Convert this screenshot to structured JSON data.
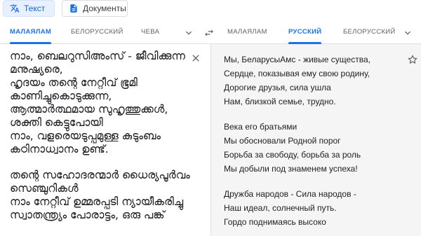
{
  "modes": {
    "text_label": "Текст",
    "docs_label": "Документы"
  },
  "source_langs": [
    "МАЛАЯЛАМ",
    "БЕЛОРУССКИЙ",
    "ЧЕВА"
  ],
  "target_langs": [
    "МАЛАЯЛАМ",
    "РУССКИЙ",
    "БЕЛОРУССКИЙ"
  ],
  "source_text": {
    "stanza1": [
      "നാം, ബെലറുസിഅംസ് - ജീവിക്കുന്ന",
      "മനുഷ്യരെ,",
      "ഹൃദയം തന്റെ നേറ്റീവ് ഭൂമി",
      "കാണിച്ചുകൊടുക്കുന്ന,",
      "ആത്മാർത്ഥമായ സുഹൃത്തുക്കൾ,",
      "ശക്തി കെട്ടുപോയി",
      "നാം, വളരെയടുപ്പമുള്ള കുടുംബം",
      "കഠിനാധ്വാനം ഉണ്ട്."
    ],
    "stanza2": [
      "തന്റെ സഹോദരന്മാർ ധൈര്യപൂർവം",
      "സെഞ്ചുറികൾ",
      "നാം നേറ്റീവ് ഉമ്മരപ്പടി ന്യായീകരിച്ചു",
      "സ്വാതന്ത്ര്യം പോരാട്ടം, ഒരു പങ്ക്"
    ]
  },
  "translation": {
    "stanza1": [
      "Мы, БеларусыАмс - живые существа,",
      "Сердце, показывая ему свою родину,",
      "Дорогие друзья, сила ушла",
      "Нам, близкой семье, трудно."
    ],
    "stanza2": [
      "Века его братьями",
      "Мы обосновали Родной порог",
      "Борьба за свободу, борьба за роль",
      "Мы добыли под знаменем успеха!"
    ],
    "stanza3": [
      "Дружба народов - Сила народов -",
      "Наш идеал, солнечный путь.",
      "Гордо поднимаясь высоко"
    ]
  },
  "icons": {
    "translate": "translate-icon",
    "document": "document-icon",
    "chevron": "chevron-down-icon",
    "swap": "swap-arrows-icon",
    "close": "close-icon",
    "star": "star-icon"
  },
  "colors": {
    "accent": "#1a73e8",
    "tab_inactive": "#5f6368",
    "chip_active_bg": "#e8f0fe",
    "output_bg": "#f5f5f5"
  }
}
